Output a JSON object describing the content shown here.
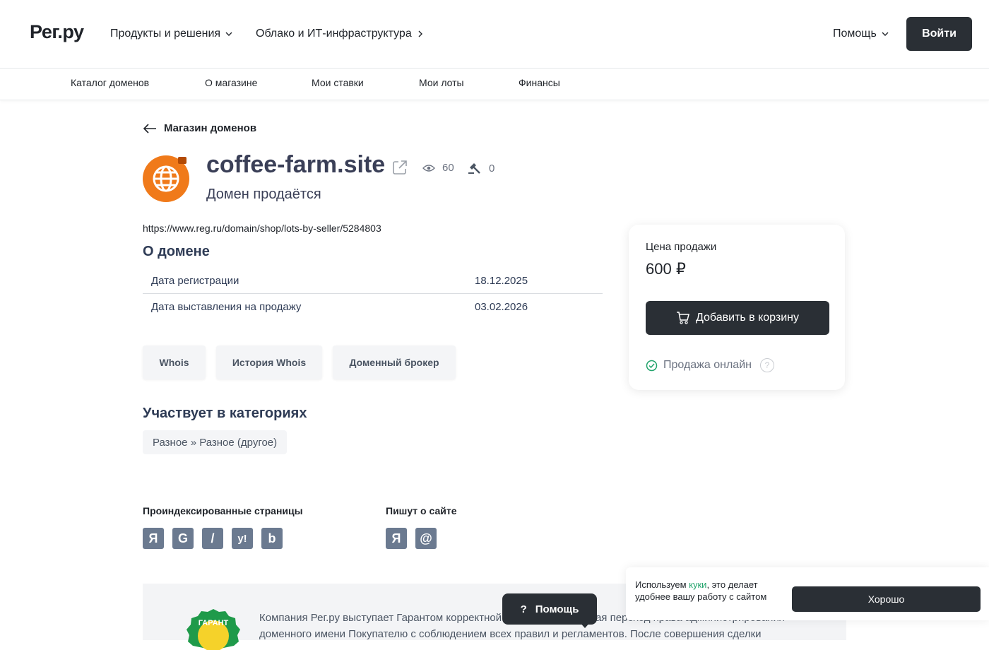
{
  "header": {
    "logo": "Рег.ру",
    "nav": [
      {
        "label": "Продукты и решения"
      },
      {
        "label": "Облако и ИТ-инфраструктура"
      }
    ],
    "help_label": "Помощь",
    "login_label": "Войти"
  },
  "subnav": {
    "items": [
      {
        "label": "Каталог доменов"
      },
      {
        "label": "О магазине"
      },
      {
        "label": "Мои ставки"
      },
      {
        "label": "Мои лоты"
      },
      {
        "label": "Финансы"
      }
    ]
  },
  "main": {
    "back_label": "Магазин доменов",
    "domain_name": "coffee-farm.site",
    "views": "60",
    "bids": "0",
    "status": "Домен продаётся",
    "url": "https://www.reg.ru/domain/shop/lots-by-seller/5284803",
    "about_title": "О домене",
    "info": [
      {
        "label": "Дата регистрации",
        "value": "18.12.2025"
      },
      {
        "label": "Дата выставления на продажу",
        "value": "03.02.2026"
      }
    ],
    "tools": [
      {
        "label": "Whois"
      },
      {
        "label": "История Whois"
      },
      {
        "label": "Доменный брокер"
      }
    ],
    "categories_title": "Участвует в категориях",
    "category": "Разное » Разное (другое)",
    "indexed_title": "Проиндексированные страницы",
    "mentions_title": "Пишут о сайте",
    "indexed_icons": [
      "yandex-icon",
      "google-icon",
      "rambler-icon",
      "yahoo-icon",
      "bing-icon"
    ],
    "mentions_icons": [
      "yandex-icon",
      "mail-icon"
    ]
  },
  "price_card": {
    "label": "Цена продажи",
    "value": "600 ₽",
    "cart_label": "Добавить в корзину",
    "online_label": "Продажа онлайн"
  },
  "guarantee": {
    "badge_text": "ГАРАНТ",
    "text": "Компания Рег.ру выступает Гарантом корректной сделки, обеспечивая переход права администрирования доменного имени Покупателю с соблюдением всех правил и регламентов. После совершения сделки"
  },
  "help_float": {
    "label": "Помощь"
  },
  "cookie": {
    "text_before": "Используем ",
    "link": "куки",
    "text_after": ", это делает удобнее вашу работу с сайтом",
    "button": "Хорошо"
  },
  "colors": {
    "dark_button": "#2a2f35",
    "domain_icon": "#f07a1a",
    "accent_green": "#21a36b",
    "title_color": "#3a3f57"
  }
}
